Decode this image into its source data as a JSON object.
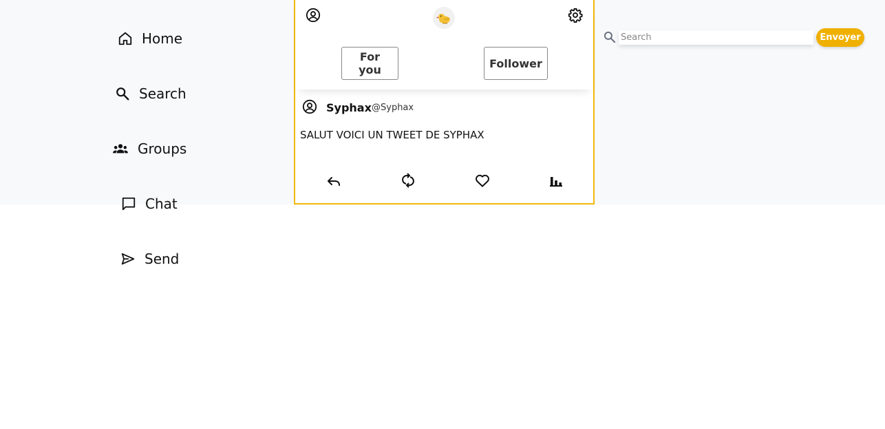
{
  "sidebar": {
    "items": [
      {
        "label": "Home",
        "icon": "home-icon"
      },
      {
        "label": "Search",
        "icon": "search-icon"
      },
      {
        "label": "Groups",
        "icon": "groups-icon"
      },
      {
        "label": "Chat",
        "icon": "chat-icon"
      },
      {
        "label": "Send",
        "icon": "send-icon"
      }
    ]
  },
  "header": {
    "profile_icon": "account-circle-icon",
    "logo_icon": "bird-logo-icon",
    "settings_icon": "gear-icon",
    "tabs": [
      {
        "label": "For you"
      },
      {
        "label": "Follower"
      }
    ]
  },
  "tweet": {
    "name": "Syphax",
    "handle": "@Syphax",
    "text": "SALUT VOICI UN TWEET DE SYPHAX",
    "actions": [
      "reply-icon",
      "retweet-icon",
      "heart-icon",
      "stats-icon"
    ]
  },
  "search": {
    "placeholder": "Search",
    "value": "",
    "submit_label": "Envoyer"
  },
  "colors": {
    "accent": "#f0b000",
    "panel_border": "#f0b90b",
    "band_background": "#f8f9fb"
  }
}
